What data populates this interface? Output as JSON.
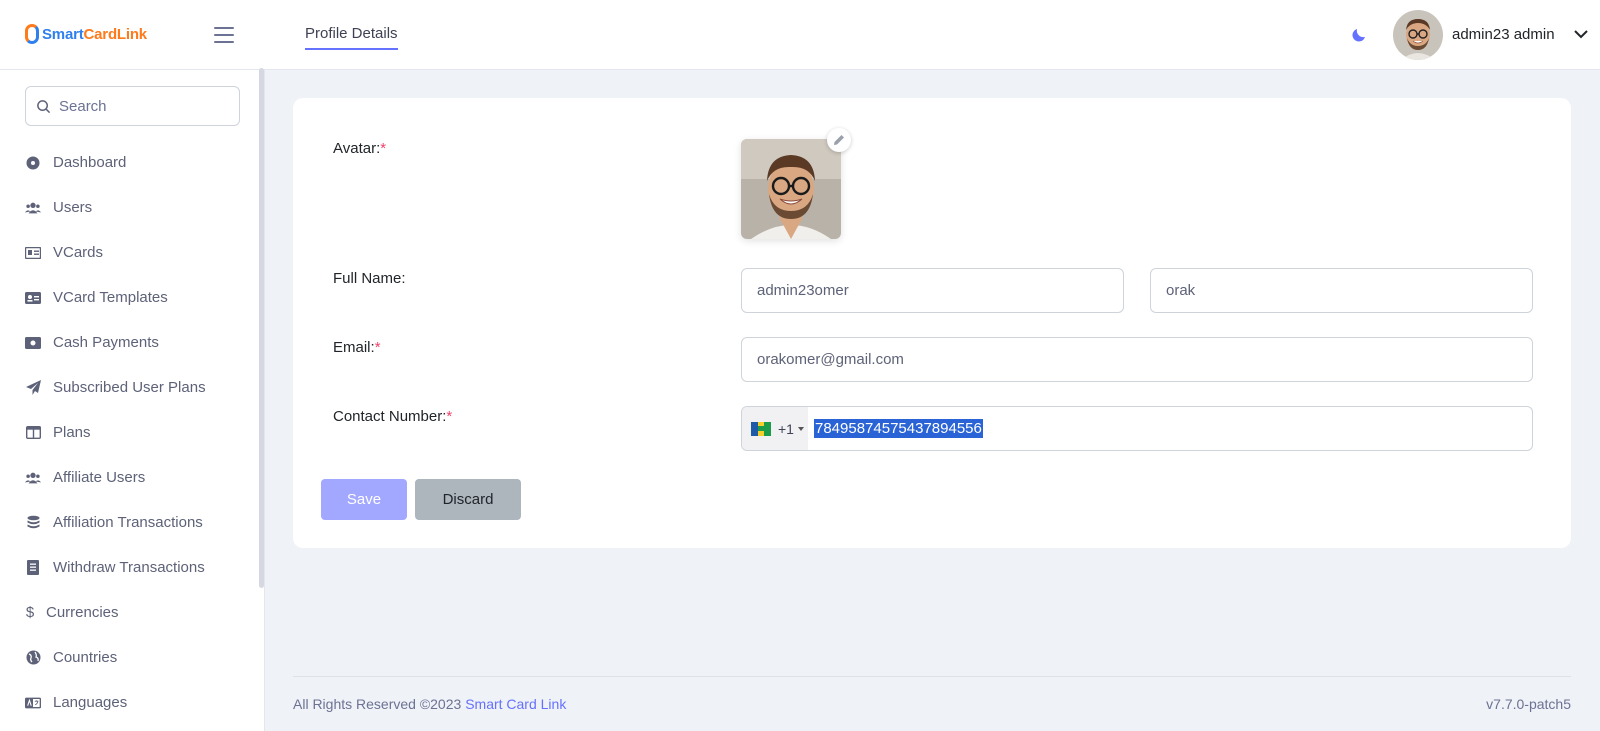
{
  "brand": {
    "part1": "Smart",
    "part2": "CardLink"
  },
  "header": {
    "tab": "Profile Details",
    "user_name": "admin23 admin"
  },
  "search": {
    "placeholder": "Search"
  },
  "sidebar": {
    "items": [
      {
        "label": "Dashboard",
        "icon": "dashboard-icon"
      },
      {
        "label": "Users",
        "icon": "users-icon"
      },
      {
        "label": "VCards",
        "icon": "vcard-icon"
      },
      {
        "label": "VCard Templates",
        "icon": "id-card-icon"
      },
      {
        "label": "Cash Payments",
        "icon": "money-bill-icon"
      },
      {
        "label": "Subscribed User Plans",
        "icon": "paper-plane-icon"
      },
      {
        "label": "Plans",
        "icon": "table-columns-icon"
      },
      {
        "label": "Affiliate Users",
        "icon": "users-icon"
      },
      {
        "label": "Affiliation Transactions",
        "icon": "coins-icon"
      },
      {
        "label": "Withdraw Transactions",
        "icon": "receipt-icon"
      },
      {
        "label": "Currencies",
        "icon": "dollar-icon"
      },
      {
        "label": "Countries",
        "icon": "globe-icon"
      },
      {
        "label": "Languages",
        "icon": "language-icon"
      }
    ]
  },
  "form": {
    "avatar_label": "Avatar:",
    "fullname_label": "Full Name:",
    "first_name": "admin23omer",
    "last_name": "orak",
    "email_label": "Email:",
    "email": "orakomer@gmail.com",
    "contact_label": "Contact Number:",
    "dial_code": "+1",
    "phone": "784958745754378945​56",
    "required_mark": "*",
    "save": "Save",
    "discard": "Discard"
  },
  "footer": {
    "rights": "All Rights Reserved ©2023 ",
    "link": "Smart Card Link",
    "version": "v7.7.0-patch5"
  },
  "colors": {
    "primary": "#6571ff",
    "save_button": "#a2a8ff",
    "discard_button": "#adb5bd",
    "required": "#f1416c",
    "background": "#eff2f7"
  }
}
